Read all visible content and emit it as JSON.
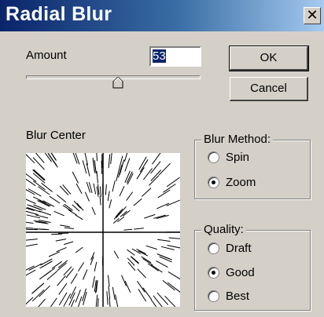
{
  "window": {
    "title": "Radial Blur",
    "close_glyph": "✕"
  },
  "amount": {
    "label": "Amount",
    "value": "53"
  },
  "buttons": {
    "ok_label": "OK",
    "cancel_label": "Cancel"
  },
  "blur_center": {
    "label": "Blur Center"
  },
  "blur_method": {
    "legend": "Blur Method:",
    "options": [
      {
        "label": "Spin",
        "checked": false
      },
      {
        "label": "Zoom",
        "checked": true
      }
    ]
  },
  "quality": {
    "legend": "Quality:",
    "options": [
      {
        "label": "Draft",
        "checked": false
      },
      {
        "label": "Good",
        "checked": true
      },
      {
        "label": "Best",
        "checked": false
      }
    ]
  },
  "colors": {
    "titlebar_start": "#0a246a",
    "titlebar_end": "#a6caf0",
    "dialog_face": "#d4d0c8"
  }
}
